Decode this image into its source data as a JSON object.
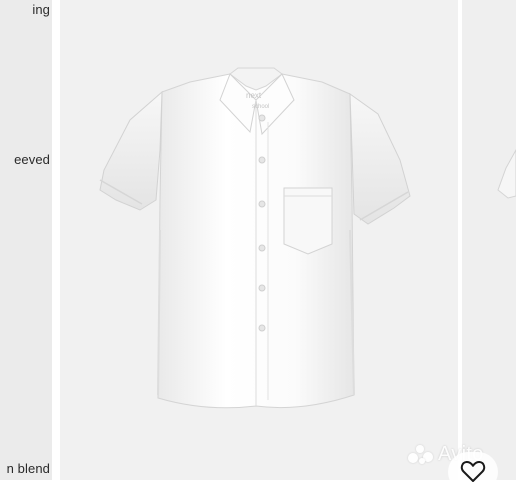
{
  "left_panel": {
    "fragments": [
      "ing",
      "eeved",
      "n blend"
    ]
  },
  "product": {
    "collar_label_brand": "next",
    "collar_label_line": "school"
  },
  "watermark": {
    "text": "Avito"
  },
  "favorite": {
    "icon": "heart-icon"
  }
}
